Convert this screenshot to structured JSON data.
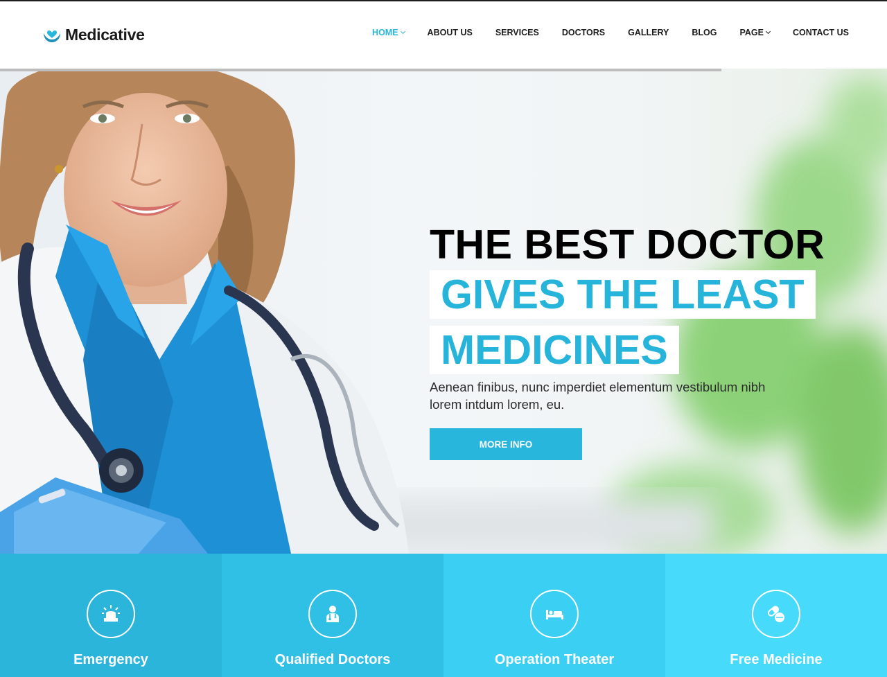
{
  "brand": {
    "name": "Medicative",
    "icon": "heart-hands-icon",
    "accent": "#29b6dc"
  },
  "nav": {
    "items": [
      {
        "label": "HOME",
        "active": true,
        "dropdown": true
      },
      {
        "label": "ABOUT US"
      },
      {
        "label": "SERVICES"
      },
      {
        "label": "DOCTORS"
      },
      {
        "label": "GALLERY"
      },
      {
        "label": "BLOG"
      },
      {
        "label": "PAGE",
        "dropdown": true
      },
      {
        "label": "CONTACT US"
      }
    ]
  },
  "hero": {
    "line1": "THE BEST DOCTOR",
    "line2": "GIVES THE LEAST",
    "line3": "MEDICINES",
    "description": "Aenean finibus, nunc imperdiet elementum vestibulum nibh lorem intdum lorem, eu.",
    "button": "MORE INFO"
  },
  "features": [
    {
      "label": "Emergency",
      "icon": "siren-icon",
      "color": "#2bb5db"
    },
    {
      "label": "Qualified Doctors",
      "icon": "doctor-icon",
      "color": "#30c0e6"
    },
    {
      "label": "Operation Theater",
      "icon": "bed-icon",
      "color": "#3bd0f3"
    },
    {
      "label": "Free Medicine",
      "icon": "pills-icon",
      "color": "#47dafb"
    }
  ]
}
